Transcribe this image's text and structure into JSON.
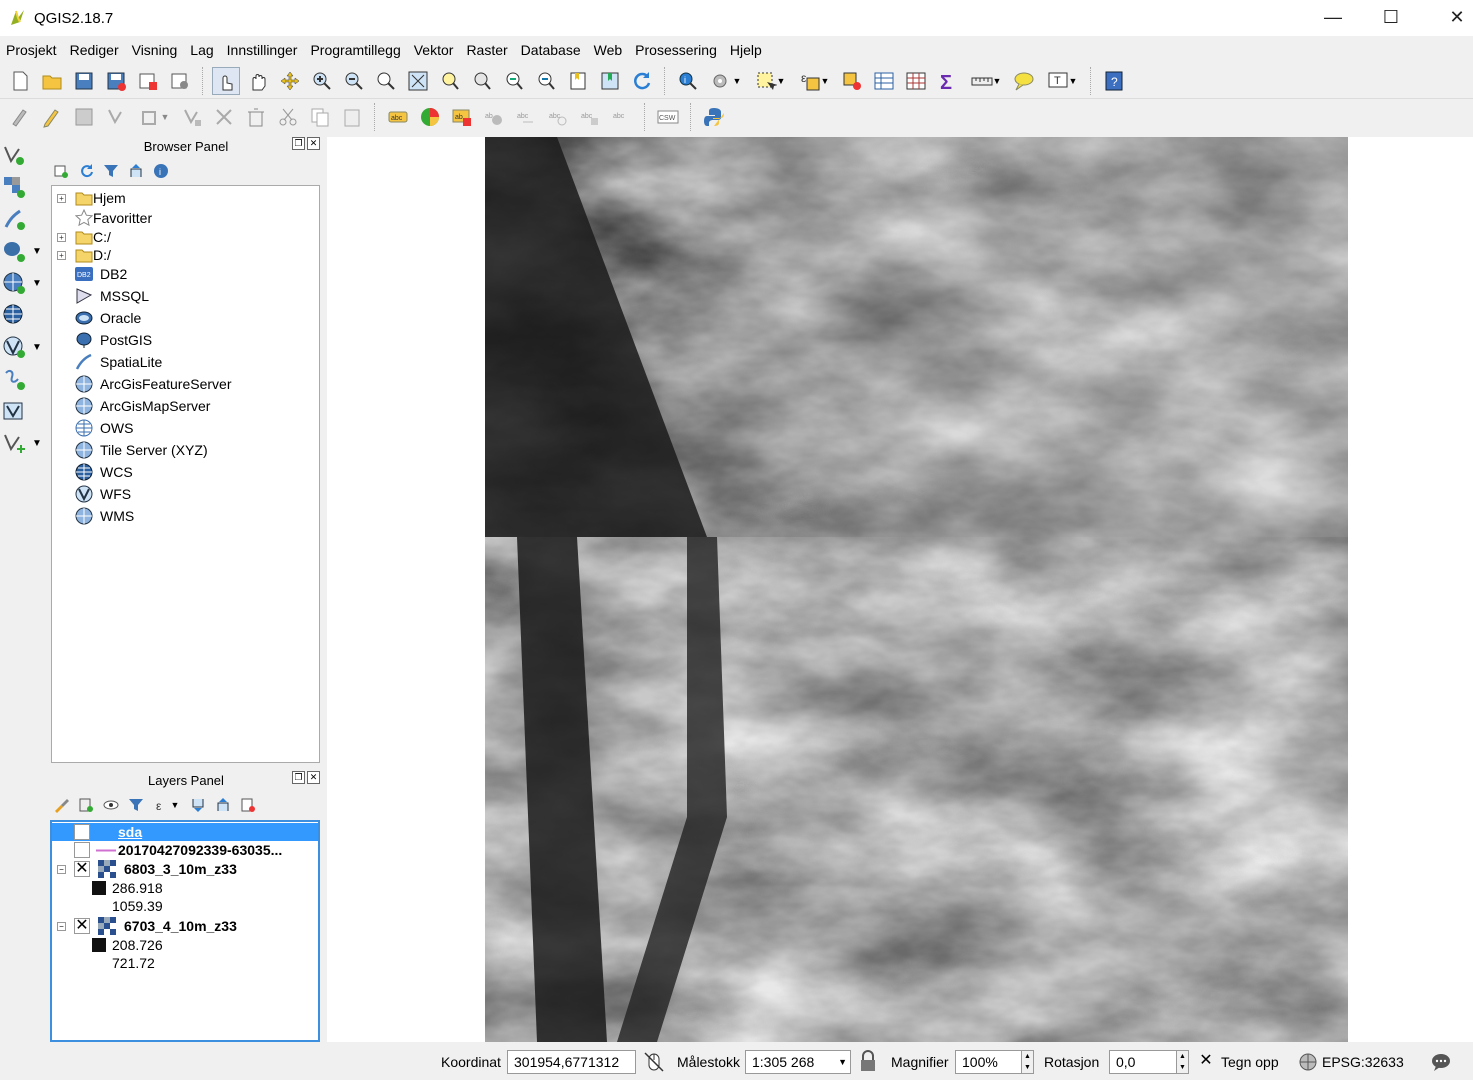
{
  "window": {
    "title": "QGIS2.18.7",
    "minimize": "—",
    "maximize": "☐",
    "close": "✕"
  },
  "menu": [
    "Prosjekt",
    "Rediger",
    "Visning",
    "Lag",
    "Innstillinger",
    "Programtillegg",
    "Vektor",
    "Raster",
    "Database",
    "Web",
    "Prosessering",
    "Hjelp"
  ],
  "browser_panel": {
    "title": "Browser Panel",
    "items": [
      {
        "label": "Hjem",
        "icon": "folder-icon",
        "expandable": true
      },
      {
        "label": "Favoritter",
        "icon": "star-icon",
        "expandable": false
      },
      {
        "label": "C:/",
        "icon": "folder-icon",
        "expandable": true
      },
      {
        "label": "D:/",
        "icon": "folder-icon",
        "expandable": true
      },
      {
        "label": "DB2",
        "icon": "db2-icon",
        "expandable": false
      },
      {
        "label": "MSSQL",
        "icon": "mssql-icon",
        "expandable": false
      },
      {
        "label": "Oracle",
        "icon": "oracle-icon",
        "expandable": false
      },
      {
        "label": "PostGIS",
        "icon": "postgis-icon",
        "expandable": false
      },
      {
        "label": "SpatiaLite",
        "icon": "spatialite-icon",
        "expandable": false
      },
      {
        "label": "ArcGisFeatureServer",
        "icon": "globe-icon",
        "expandable": false
      },
      {
        "label": "ArcGisMapServer",
        "icon": "globe-icon",
        "expandable": false
      },
      {
        "label": "OWS",
        "icon": "ows-icon",
        "expandable": false
      },
      {
        "label": "Tile Server (XYZ)",
        "icon": "globe-icon",
        "expandable": false
      },
      {
        "label": "WCS",
        "icon": "wcs-icon",
        "expandable": false
      },
      {
        "label": "WFS",
        "icon": "wfs-icon",
        "expandable": false
      },
      {
        "label": "WMS",
        "icon": "wms-icon",
        "expandable": false
      }
    ]
  },
  "layers_panel": {
    "title": "Layers Panel",
    "layers": [
      {
        "name": "sda",
        "checked": false,
        "selected": true
      },
      {
        "name": "20170427092339-63035...",
        "checked": false,
        "selected": false
      },
      {
        "name": "6803_3_10m_z33",
        "checked": true,
        "min": "286.918",
        "max": "1059.39"
      },
      {
        "name": "6703_4_10m_z33",
        "checked": true,
        "min": "208.726",
        "max": "721.72"
      }
    ]
  },
  "status": {
    "coord_label": "Koordinat",
    "coord_value": "301954,6771312",
    "scale_label": "Målestokk",
    "scale_value": "1:305 268",
    "magnifier_label": "Magnifier",
    "magnifier_value": "100%",
    "rotation_label": "Rotasjon",
    "rotation_value": "0,0",
    "render_label": "Tegn opp",
    "crs": "EPSG:32633"
  },
  "colors": {
    "selection": "#3399ff",
    "layers_border": "#3c8fdf"
  }
}
